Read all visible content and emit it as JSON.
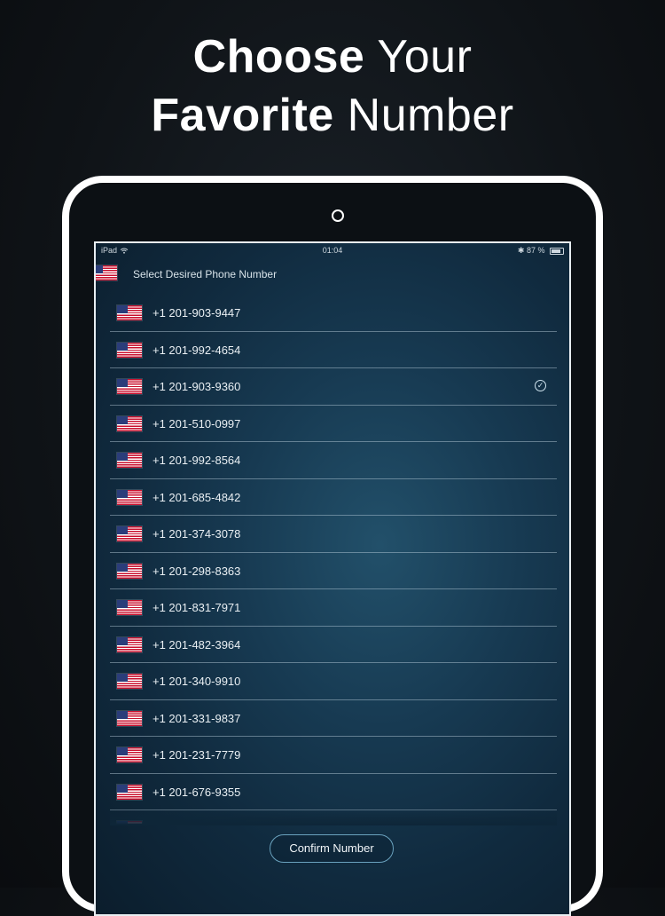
{
  "headline": {
    "line1_bold": "Choose",
    "line1_light": "Your",
    "line2_bold": "Favorite",
    "line2_light": "Number"
  },
  "status_bar": {
    "device": "iPad",
    "time": "01:04",
    "battery": "87 %",
    "wifi_icon": "wifi-icon",
    "bluetooth_icon": "bluetooth-icon"
  },
  "nav": {
    "title": "Select Desired Phone Number",
    "back_icon": "chevron-left-icon",
    "flag_icon": "us-flag-icon"
  },
  "numbers": [
    {
      "number": "+1 201-903-9447",
      "selected": false
    },
    {
      "number": "+1 201-992-4654",
      "selected": false
    },
    {
      "number": "+1 201-903-9360",
      "selected": true
    },
    {
      "number": "+1 201-510-0997",
      "selected": false
    },
    {
      "number": "+1 201-992-8564",
      "selected": false
    },
    {
      "number": "+1 201-685-4842",
      "selected": false
    },
    {
      "number": "+1 201-374-3078",
      "selected": false
    },
    {
      "number": "+1 201-298-8363",
      "selected": false
    },
    {
      "number": "+1 201-831-7971",
      "selected": false
    },
    {
      "number": "+1 201-482-3964",
      "selected": false
    },
    {
      "number": "+1 201-340-9910",
      "selected": false
    },
    {
      "number": "+1 201-331-9837",
      "selected": false
    },
    {
      "number": "+1 201-231-7779",
      "selected": false
    },
    {
      "number": "+1 201-676-9355",
      "selected": false
    },
    {
      "number": "+1 201-730-5523",
      "selected": false
    }
  ],
  "confirm_label": "Confirm Number",
  "colors": {
    "accent": "#3fb2ea",
    "button_border": "#6aa2be"
  }
}
